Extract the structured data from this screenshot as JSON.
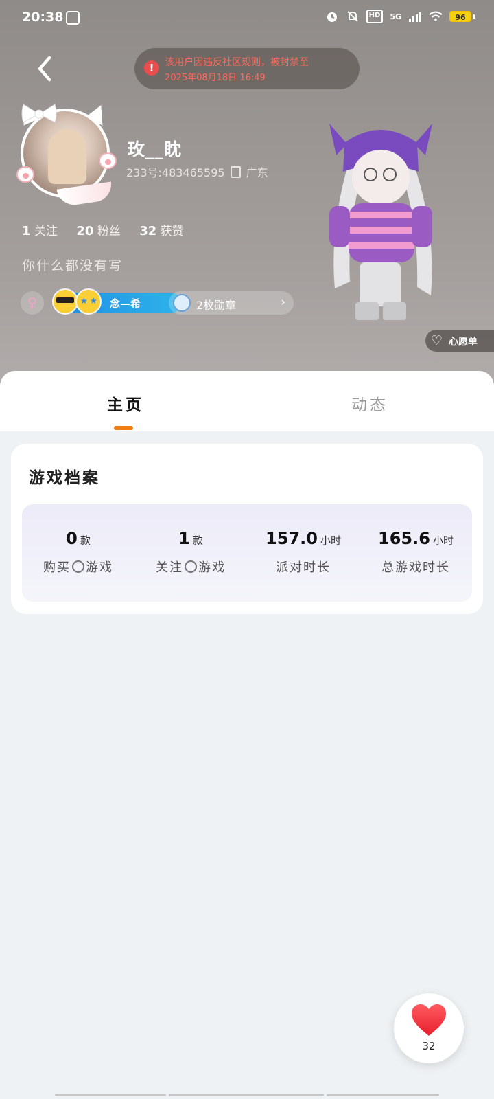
{
  "status_bar": {
    "time": "20:38",
    "network": "5G",
    "hd": "HD",
    "battery": "96"
  },
  "ban_notice": {
    "line1": "该用户因违反社区规则，被封禁至",
    "line2": "2025年08月18日 16:49"
  },
  "profile": {
    "username": "玫__眈",
    "id_text": "233号:483465595",
    "location": "广东",
    "follow_count": "1",
    "follow_label": "关注",
    "fans_count": "20",
    "fans_label": "粉丝",
    "likes_count": "32",
    "likes_label": "获赞",
    "bio": "你什么都没有写",
    "intimacy_name": "念—希",
    "medal_text": "2枚勋章",
    "wish_label": "心愿单"
  },
  "tabs": [
    {
      "label": "主页"
    },
    {
      "label": "动态"
    }
  ],
  "game_card": {
    "title": "游戏档案",
    "stats": [
      {
        "value": "0",
        "unit": "款",
        "label_pre": "购买",
        "label_post": "游戏"
      },
      {
        "value": "1",
        "unit": "款",
        "label_pre": "关注",
        "label_post": "游戏"
      },
      {
        "value": "157.0",
        "unit": "小时",
        "label_pre": "派对时长",
        "label_post": ""
      },
      {
        "value": "165.6",
        "unit": "小时",
        "label_pre": "总游戏时长",
        "label_post": ""
      }
    ]
  },
  "like": {
    "count": "32"
  },
  "colors": {
    "accent_orange": "#f07d12",
    "ban_red": "#ea4d4d",
    "intimacy_blue": "#1f8de6",
    "like_red": "#f43a44"
  }
}
